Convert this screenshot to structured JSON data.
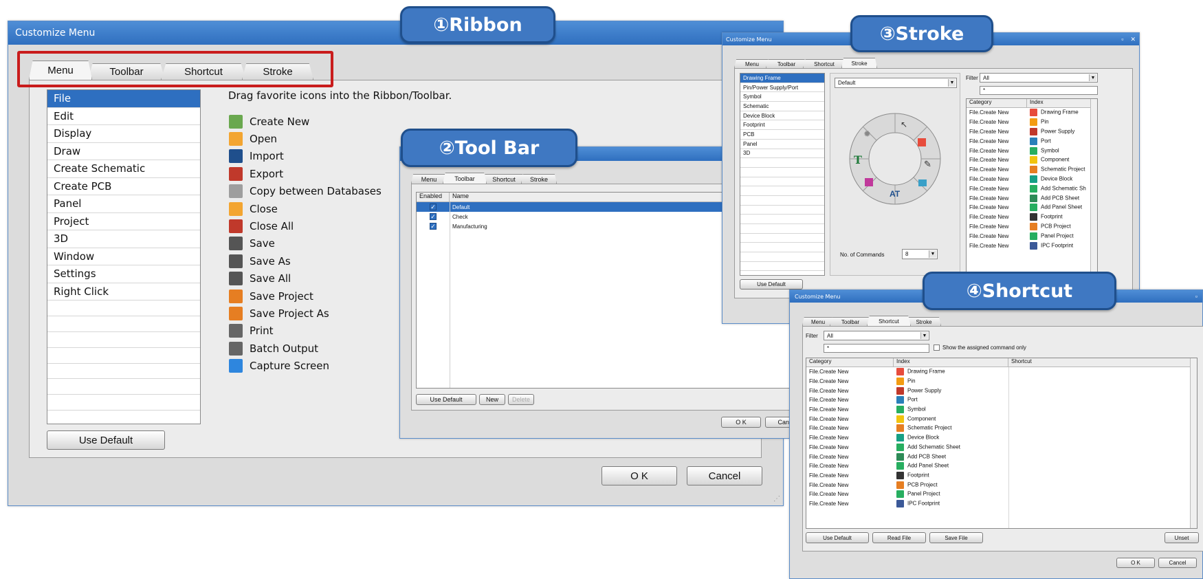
{
  "callouts": {
    "ribbon": "①Ribbon",
    "toolbar": "②Tool Bar",
    "stroke": "③Stroke",
    "shortcut": "④Shortcut"
  },
  "main": {
    "title": "Customize Menu",
    "tabs": [
      "Menu",
      "Toolbar",
      "Shortcut",
      "Stroke"
    ],
    "categories": [
      "File",
      "Edit",
      "Display",
      "Draw",
      "Create Schematic",
      "Create PCB",
      "Panel",
      "Project",
      "3D",
      "Window",
      "Settings",
      "Right Click"
    ],
    "hint": "Drag favorite icons into the Ribbon/Toolbar.",
    "commands": [
      {
        "label": "Create New",
        "icon": "pencil-icon",
        "color": "#6aa84f"
      },
      {
        "label": "Open",
        "icon": "folder-open-icon",
        "color": "#f3a531"
      },
      {
        "label": "Import",
        "icon": "import-icon",
        "color": "#1f4f8c"
      },
      {
        "label": "Export",
        "icon": "export-icon",
        "color": "#c0392b"
      },
      {
        "label": "Copy between Databases",
        "icon": "copy-icon",
        "color": "#9e9e9e"
      },
      {
        "label": "Close",
        "icon": "folder-close-icon",
        "color": "#f3a531"
      },
      {
        "label": "Close All",
        "icon": "close-all-icon",
        "color": "#c0392b"
      },
      {
        "label": "Save",
        "icon": "save-icon",
        "color": "#555555"
      },
      {
        "label": "Save As",
        "icon": "save-as-icon",
        "color": "#555555"
      },
      {
        "label": "Save All",
        "icon": "save-all-icon",
        "color": "#555555"
      },
      {
        "label": "Save Project",
        "icon": "save-project-icon",
        "color": "#e67e22"
      },
      {
        "label": "Save Project As",
        "icon": "save-project-as-icon",
        "color": "#e67e22"
      },
      {
        "label": "Print",
        "icon": "print-icon",
        "color": "#666666"
      },
      {
        "label": "Batch Output",
        "icon": "batch-output-icon",
        "color": "#666666"
      },
      {
        "label": "Capture Screen",
        "icon": "camera-icon",
        "color": "#2e86de"
      }
    ],
    "use_default": "Use Default",
    "ok": "O K",
    "cancel": "Cancel"
  },
  "toolbar_win": {
    "tabs": [
      "Menu",
      "Toolbar",
      "Shortcut",
      "Stroke"
    ],
    "col_enabled": "Enabled",
    "col_name": "Name",
    "rows": [
      {
        "name": "Default",
        "checked": true,
        "selected": true
      },
      {
        "name": "Check",
        "checked": true,
        "selected": false
      },
      {
        "name": "Manufacturing",
        "checked": true,
        "selected": false
      }
    ],
    "use_default": "Use Default",
    "new": "New",
    "delete": "Delete",
    "ok": "O K",
    "cancel": "Canc"
  },
  "stroke_win": {
    "title": "Customize Menu",
    "tabs": [
      "Menu",
      "Toolbar",
      "Shortcut",
      "Stroke"
    ],
    "categories": [
      "Drawing Frame",
      "Pin/Power Supply/Port",
      "Symbol",
      "Schematic",
      "Device Block",
      "Footprint",
      "PCB",
      "Panel",
      "3D"
    ],
    "preset": "Default",
    "filter_label": "Filter",
    "filter_value": "All",
    "filter_text": "*",
    "col_category": "Category",
    "col_index": "Index",
    "rows": [
      {
        "cat": "File.Create New",
        "idx": "Drawing Frame",
        "color": "#e74c3c"
      },
      {
        "cat": "File.Create New",
        "idx": "Pin",
        "color": "#f39c12"
      },
      {
        "cat": "File.Create New",
        "idx": "Power Supply",
        "color": "#c0392b"
      },
      {
        "cat": "File.Create New",
        "idx": "Port",
        "color": "#2980b9"
      },
      {
        "cat": "File.Create New",
        "idx": "Symbol",
        "color": "#27ae60"
      },
      {
        "cat": "File.Create New",
        "idx": "Component",
        "color": "#f1c40f"
      },
      {
        "cat": "File.Create New",
        "idx": "Schematic Project",
        "color": "#e67e22"
      },
      {
        "cat": "File.Create New",
        "idx": "Device Block",
        "color": "#16a085"
      },
      {
        "cat": "File.Create New",
        "idx": "Add Schematic Sh",
        "color": "#27ae60"
      },
      {
        "cat": "File.Create New",
        "idx": "Add PCB Sheet",
        "color": "#2e8b57"
      },
      {
        "cat": "File.Create New",
        "idx": "Add Panel Sheet",
        "color": "#27ae60"
      },
      {
        "cat": "File.Create New",
        "idx": "Footprint",
        "color": "#333333"
      },
      {
        "cat": "File.Create New",
        "idx": "PCB Project",
        "color": "#e67e22"
      },
      {
        "cat": "File.Create New",
        "idx": "Panel Project",
        "color": "#27ae60"
      },
      {
        "cat": "File.Create New",
        "idx": "IPC Footprint",
        "color": "#3b5998"
      }
    ],
    "commands_label": "No. of Commands",
    "commands_value": "8",
    "use_default": "Use Default"
  },
  "shortcut_win": {
    "title": "Customize Menu",
    "tabs": [
      "Menu",
      "Toolbar",
      "Shortcut",
      "Stroke"
    ],
    "filter_label": "Filter",
    "filter_value": "All",
    "filter_text": "*",
    "show_assigned": "Show the assigned command only",
    "col_category": "Category",
    "col_index": "Index",
    "col_shortcut": "Shortcut",
    "rows": [
      {
        "cat": "File.Create New",
        "idx": "Drawing Frame",
        "color": "#e74c3c"
      },
      {
        "cat": "File.Create New",
        "idx": "Pin",
        "color": "#f39c12"
      },
      {
        "cat": "File.Create New",
        "idx": "Power Supply",
        "color": "#c0392b"
      },
      {
        "cat": "File.Create New",
        "idx": "Port",
        "color": "#2980b9"
      },
      {
        "cat": "File.Create New",
        "idx": "Symbol",
        "color": "#27ae60"
      },
      {
        "cat": "File.Create New",
        "idx": "Component",
        "color": "#f1c40f"
      },
      {
        "cat": "File.Create New",
        "idx": "Schematic Project",
        "color": "#e67e22"
      },
      {
        "cat": "File.Create New",
        "idx": "Device Block",
        "color": "#16a085"
      },
      {
        "cat": "File.Create New",
        "idx": "Add Schematic Sheet",
        "color": "#27ae60"
      },
      {
        "cat": "File.Create New",
        "idx": "Add PCB Sheet",
        "color": "#2e8b57"
      },
      {
        "cat": "File.Create New",
        "idx": "Add Panel Sheet",
        "color": "#27ae60"
      },
      {
        "cat": "File.Create New",
        "idx": "Footprint",
        "color": "#333333"
      },
      {
        "cat": "File.Create New",
        "idx": "PCB Project",
        "color": "#e67e22"
      },
      {
        "cat": "File.Create New",
        "idx": "Panel Project",
        "color": "#27ae60"
      },
      {
        "cat": "File.Create New",
        "idx": "IPC Footprint",
        "color": "#3b5998"
      }
    ],
    "use_default": "Use Default",
    "read_file": "Read File",
    "save_file": "Save File",
    "unset": "Unset",
    "ok": "O K",
    "cancel": "Cancel"
  }
}
